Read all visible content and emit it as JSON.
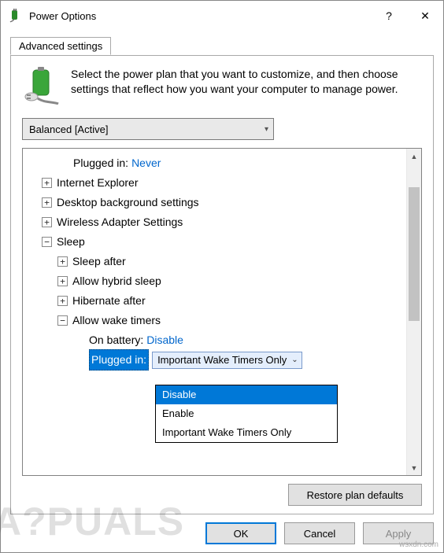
{
  "window": {
    "title": "Power Options",
    "help_label": "?",
    "close_label": "✕"
  },
  "tab": {
    "advanced": "Advanced settings"
  },
  "description": "Select the power plan that you want to customize, and then choose settings that reflect how you want your computer to manage power.",
  "plan_dropdown": {
    "selected": "Balanced [Active]"
  },
  "tree": {
    "plugged_top": {
      "label": "Plugged in:",
      "value": "Never"
    },
    "ie": "Internet Explorer",
    "desktop": "Desktop background settings",
    "wireless": "Wireless Adapter Settings",
    "sleep": {
      "label": "Sleep",
      "sleep_after": "Sleep after",
      "hybrid": "Allow hybrid sleep",
      "hibernate": "Hibernate after",
      "wake": {
        "label": "Allow wake timers",
        "on_battery": {
          "label": "On battery:",
          "value": "Disable"
        },
        "plugged_in": {
          "label": "Plugged in:",
          "value": "Important Wake Timers Only"
        }
      }
    }
  },
  "dropdown_options": {
    "o1": "Disable",
    "o2": "Enable",
    "o3": "Important Wake Timers Only"
  },
  "buttons": {
    "restore": "Restore plan defaults",
    "ok": "OK",
    "cancel": "Cancel",
    "apply": "Apply"
  },
  "watermark": "A?PUALS",
  "wm_caption": "wsxdn.com"
}
